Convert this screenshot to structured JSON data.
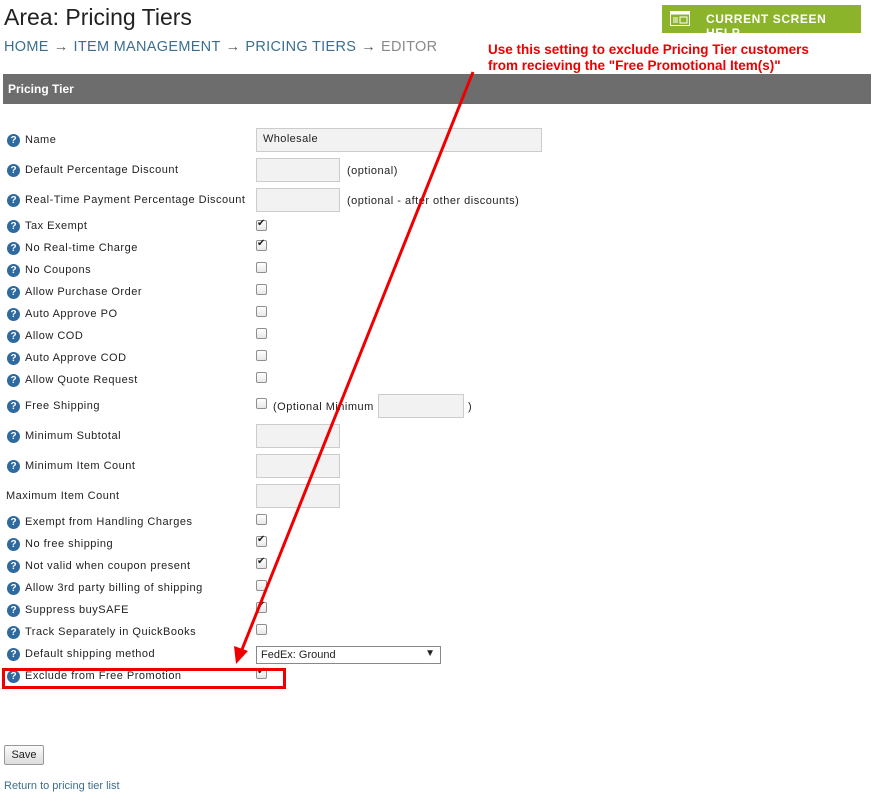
{
  "header": {
    "title": "Area: Pricing Tiers",
    "breadcrumb": [
      "HOME",
      "ITEM MANAGEMENT",
      "PRICING TIERS",
      "EDITOR"
    ],
    "breadcrumb_sep": "→",
    "help_button": "CURRENT SCREEN HELP"
  },
  "annotation": {
    "line1": "Use this setting to exclude Pricing Tier customers",
    "line2": "from recieving the \"Free Promotional Item(s)\"",
    "color": "#ee0000"
  },
  "section": {
    "title": "Pricing Tier"
  },
  "form": {
    "help_glyph": "?",
    "name": {
      "label": "Name",
      "value": "Wholesale"
    },
    "default_pct": {
      "label": "Default Percentage Discount",
      "value": "",
      "hint": "(optional)"
    },
    "realtime_pct": {
      "label": "Real-Time Payment Percentage Discount",
      "value": "",
      "hint": "(optional - after other discounts)"
    },
    "tax_exempt": {
      "label": "Tax Exempt",
      "checked": true
    },
    "no_realtime": {
      "label": "No Real-time Charge",
      "checked": true
    },
    "no_coupons": {
      "label": "No Coupons",
      "checked": false
    },
    "allow_po": {
      "label": "Allow Purchase Order",
      "checked": false
    },
    "auto_po": {
      "label": "Auto Approve PO",
      "checked": false
    },
    "allow_cod": {
      "label": "Allow COD",
      "checked": false
    },
    "auto_cod": {
      "label": "Auto Approve COD",
      "checked": false
    },
    "allow_quote": {
      "label": "Allow Quote Request",
      "checked": false
    },
    "free_ship": {
      "label": "Free Shipping",
      "checked": false,
      "hint_open": "(Optional Minimum",
      "hint_close": ")",
      "value": ""
    },
    "min_subtotal": {
      "label": "Minimum Subtotal",
      "value": ""
    },
    "min_count": {
      "label": "Minimum Item Count",
      "value": ""
    },
    "max_count": {
      "label": "Maximum Item Count",
      "value": ""
    },
    "exempt_handling": {
      "label": "Exempt from Handling Charges",
      "checked": false
    },
    "no_free_ship": {
      "label": "No free shipping",
      "checked": true
    },
    "not_valid_coupon": {
      "label": "Not valid when coupon present",
      "checked": true
    },
    "third_party": {
      "label": "Allow 3rd party billing of shipping",
      "checked": false
    },
    "suppress_buysafe": {
      "label": "Suppress buySAFE",
      "checked": true
    },
    "track_qb": {
      "label": "Track Separately in QuickBooks",
      "checked": false
    },
    "default_ship": {
      "label": "Default shipping method",
      "value": "FedEx: Ground"
    },
    "exclude_promo": {
      "label": "Exclude from Free Promotion",
      "checked": true
    }
  },
  "actions": {
    "save": "Save",
    "return_link": "Return to pricing tier list"
  },
  "colors": {
    "accent": "#8bb42a",
    "bar": "#6d6d6d",
    "link": "#3c6e8f",
    "help_icon": "#2f6a9e"
  }
}
